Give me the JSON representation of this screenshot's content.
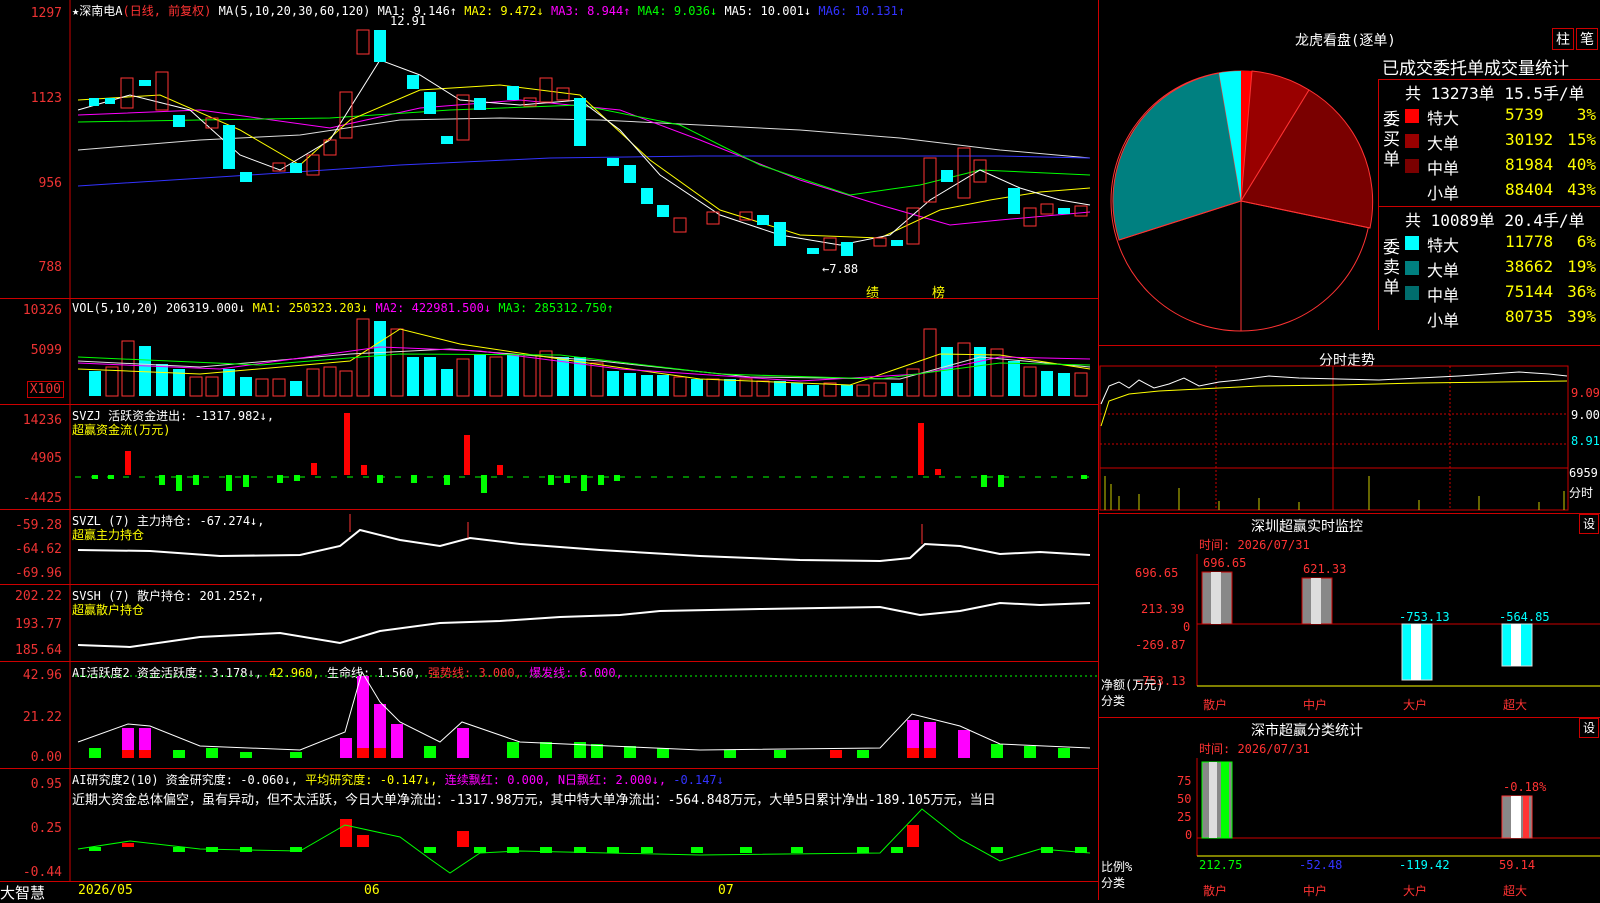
{
  "stock": {
    "name": "深南电A",
    "period": "(日线, 前复权)",
    "star": "★"
  },
  "main": {
    "ticks": [
      "1297",
      "1123",
      "956",
      "788"
    ],
    "ma_header": {
      "ma_label": "MA(5,10,20,30,60,120)",
      "ma1": "MA1: 9.146↑",
      "ma2": "MA2: 9.472↓",
      "ma3": "MA3: 8.944↑",
      "ma4": "MA4: 9.036↓",
      "ma5": "MA5: 10.001↓",
      "ma6": "MA6: 10.131↑"
    },
    "high_mark": "12.91",
    "low_mark": "←7.88",
    "ann1": "绩",
    "ann2": "榜"
  },
  "vol": {
    "header": "VOL(5,10,20)",
    "v": "206319.000↓",
    "ma1": "MA1: 250323.203↓",
    "ma2": "MA2: 422981.500↓",
    "ma3": "MA3: 285312.750↑",
    "ticks": [
      "10326",
      "5099"
    ],
    "unit": "X100"
  },
  "svzj": {
    "header": "SVZJ  活跃资金进出: -1317.982↓,",
    "sub": "超赢资金流(万元)",
    "ticks": [
      "14236",
      "4905",
      "-4425"
    ]
  },
  "svzl": {
    "header": "SVZL (7) 主力持仓: -67.274↓,",
    "sub": "超赢主力持仓",
    "ticks": [
      "-59.28",
      "-64.62",
      "-69.96"
    ]
  },
  "svsh": {
    "header": "SVSH (7) 散户持仓: 201.252↑,",
    "sub": "超赢散户持仓",
    "ticks": [
      "202.22",
      "193.77",
      "185.64"
    ]
  },
  "ai1": {
    "h1": "AI活跃度2 资金活跃度: 3.178↓,",
    "h2": "42.960,",
    "h3": "生命线: 1.560,",
    "h4": "强势线: 3.000,",
    "h5": "爆发线: 6.000,",
    "ticks": [
      "42.96",
      "21.22",
      "0.00"
    ]
  },
  "ai2": {
    "h1": "AI研究度2(10) 资金研究度: -0.060↓,",
    "h2": "平均研究度: -0.147↓,",
    "h3": "连续飘红: 0.000,",
    "h4": "N日飘红: 2.000↓,",
    "h5": "-0.147↓",
    "text": "近期大资金总体偏空，虽有异动，但不太活跃，今日大单净流出：-1317.98万元，其中特大单净流出：-564.848万元，大单5日累计净出-189.105万元，当日",
    "ticks": [
      "0.95",
      "0.25",
      "-0.44"
    ]
  },
  "dates": {
    "d1": "2026/05",
    "d2": "06",
    "d3": "07"
  },
  "brand": "大智慧",
  "lhkp": {
    "title": "龙虎看盘(逐单)",
    "btn1": "柱",
    "btn2": "笔",
    "subtitle": "已成交委托单成交量统计",
    "buy_label": "委买单",
    "sell_label": "委卖单",
    "buy_summary": "共 13273单 15.5手/单",
    "sell_summary": "共 10089单 20.4手/单",
    "buy": [
      {
        "name": "特大",
        "value": "5739",
        "pct": "3%",
        "color": "#ff0000"
      },
      {
        "name": "大单",
        "value": "30192",
        "pct": "15%",
        "color": "#990000"
      },
      {
        "name": "中单",
        "value": "81984",
        "pct": "40%",
        "color": "#7a0000"
      },
      {
        "name": "小单",
        "value": "88404",
        "pct": "43%",
        "color": "#000000"
      }
    ],
    "sell": [
      {
        "name": "特大",
        "value": "11778",
        "pct": "6%",
        "color": "#00ffff"
      },
      {
        "name": "大单",
        "value": "38662",
        "pct": "19%",
        "color": "#008080"
      },
      {
        "name": "中单",
        "value": "75144",
        "pct": "36%",
        "color": "#006d6d"
      },
      {
        "name": "小单",
        "value": "80735",
        "pct": "39%",
        "color": "#000000"
      }
    ]
  },
  "fenshi": {
    "title": "分时走势",
    "ticks": [
      "9.09",
      "9.00",
      "8.91",
      "6959"
    ],
    "unit": "分时"
  },
  "szcy": {
    "title": "深圳超赢实时监控",
    "btn": "设",
    "time": "时间: 2026/07/31",
    "ticks": [
      "696.65",
      "213.39",
      "0",
      "-269.87",
      "-753.13"
    ],
    "unit": "净额(万元)",
    "cat": "分类",
    "labels": [
      "散户",
      "中户",
      "大户",
      "超大"
    ],
    "values": [
      "696.65",
      "621.33",
      "-753.13",
      "-564.85"
    ]
  },
  "sscy": {
    "title": "深市超赢分类统计",
    "btn": "设",
    "time": "时间: 2026/07/31",
    "ticks": [
      "75",
      "50",
      "25",
      "0"
    ],
    "pct_label": "-0.18%",
    "unit": "比例%",
    "cat": "分类",
    "labels": [
      "散户",
      "中户",
      "大户",
      "超大"
    ],
    "values": [
      "212.75",
      "-52.48",
      "-119.42",
      "59.14"
    ]
  }
}
